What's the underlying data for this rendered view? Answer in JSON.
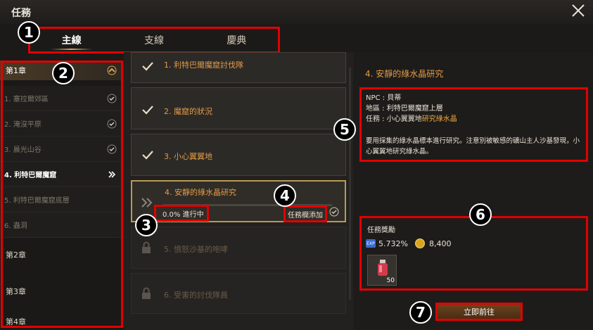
{
  "window": {
    "title": "任務"
  },
  "tabs": [
    {
      "label": "主線",
      "active": true
    },
    {
      "label": "支線",
      "active": false
    },
    {
      "label": "慶典",
      "active": false
    }
  ],
  "sidebar": {
    "chapter1": "第1章",
    "items": [
      {
        "label": "1. 塞拉爾郊區",
        "state": "done"
      },
      {
        "label": "2. 淹沒平原",
        "state": "done"
      },
      {
        "label": "3. 晨光山谷",
        "state": "done"
      },
      {
        "label": "4. 利特巴爾魔窟",
        "state": "current"
      },
      {
        "label": "5. 利特巴爾魔窟底層",
        "state": "locked"
      },
      {
        "label": "6. 蟲洞",
        "state": "locked"
      }
    ],
    "chapter2": "第2章",
    "chapter3": "第3章",
    "chapter4": "第4章"
  },
  "quests": [
    {
      "label": "1. 利特巴爾魔窟討伐隊",
      "state": "done"
    },
    {
      "label": "2. 魔窟的狀況",
      "state": "done"
    },
    {
      "label": "3. 小心翼翼地",
      "state": "done"
    },
    {
      "label": "4. 安靜的綠水晶研究",
      "state": "current"
    },
    {
      "label": "5. 憤怒沙基的咆哮",
      "state": "locked"
    },
    {
      "label": "6. 受害的討伐隊員",
      "state": "locked"
    }
  ],
  "current_quest": {
    "progress_text": "0.0% 進行中",
    "progress": 0.0,
    "add_button": "任務欄添加"
  },
  "detail": {
    "title": "4. 安靜的綠水晶研究",
    "npc": "NPC : 貝蒂",
    "area": "地區 : 利特巴爾魔窟上層",
    "task_prefix": "任務 : 小心翼翼地",
    "task_highlight": "研究綠水晶",
    "description": "要用採集的綠水晶標本進行研究。注意別被敏感的礦山主人沙基發現，小心翼翼地研究綠水晶。"
  },
  "reward": {
    "title": "任務獎勵",
    "exp_icon": "EXP",
    "exp": "5.732%",
    "gold": "8,400",
    "item_count": "50"
  },
  "goto_button": "立即前往",
  "badges": [
    "1",
    "2",
    "3",
    "4",
    "5",
    "6",
    "7"
  ],
  "colors": {
    "accent": "#e29b45",
    "annotation": "#e10000",
    "highlight": "#f0a93a"
  }
}
